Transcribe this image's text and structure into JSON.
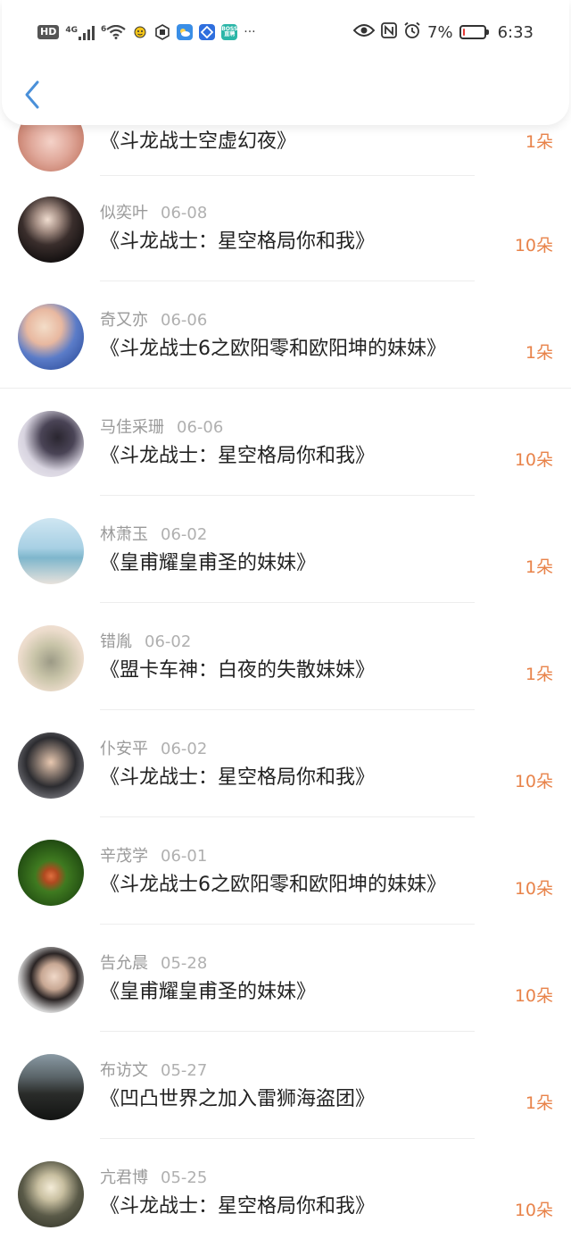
{
  "status_bar": {
    "left_badge": "HD",
    "network": "4G",
    "wifi_badge": "6",
    "app_icon_boss": "BOSS\n直聘",
    "more": "···",
    "battery_percent": "7%",
    "battery_level": 0.07,
    "time": "6:33"
  },
  "header": {
    "back_icon": "chevron-left-icon"
  },
  "colors": {
    "accent": "#4a90d9",
    "flower": "#e8834a",
    "meta": "#9a9a9a",
    "title": "#222222",
    "battery_low": "#e53935"
  },
  "rows": [
    {
      "name": "",
      "date": "",
      "title": "《斗龙战士空虚幻夜》",
      "flowers": "1朵"
    },
    {
      "name": "似奕叶",
      "date": "06-08",
      "title": "《斗龙战士：星空格局你和我》",
      "flowers": "10朵"
    },
    {
      "name": "奇又亦",
      "date": "06-06",
      "title": "《斗龙战士6之欧阳零和欧阳坤的妹妹》",
      "flowers": "1朵"
    },
    {
      "name": "马佳采珊",
      "date": "06-06",
      "title": "《斗龙战士：星空格局你和我》",
      "flowers": "10朵"
    },
    {
      "name": "林萧玉",
      "date": "06-02",
      "title": "《皇甫耀皇甫圣的妹妹》",
      "flowers": "1朵"
    },
    {
      "name": "错胤",
      "date": "06-02",
      "title": "《盟卡车神：白夜的失散妹妹》",
      "flowers": "1朵"
    },
    {
      "name": "仆安平",
      "date": "06-02",
      "title": "《斗龙战士：星空格局你和我》",
      "flowers": "10朵"
    },
    {
      "name": "辛茂学",
      "date": "06-01",
      "title": "《斗龙战士6之欧阳零和欧阳坤的妹妹》",
      "flowers": "10朵"
    },
    {
      "name": "告允晨",
      "date": "05-28",
      "title": "《皇甫耀皇甫圣的妹妹》",
      "flowers": "10朵"
    },
    {
      "name": "布访文",
      "date": "05-27",
      "title": "《凹凸世界之加入雷狮海盗团》",
      "flowers": "1朵"
    },
    {
      "name": "亢君博",
      "date": "05-25",
      "title": "《斗龙战士：星空格局你和我》",
      "flowers": "10朵"
    }
  ]
}
